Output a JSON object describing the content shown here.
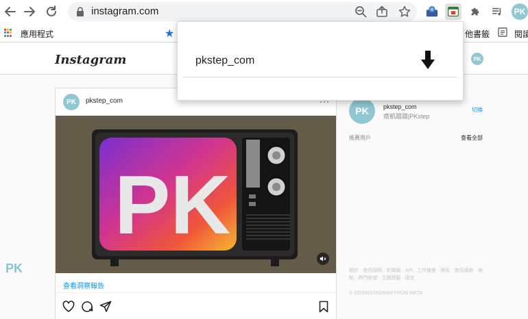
{
  "browser": {
    "url": "instagram.com",
    "bookmarks": {
      "apps_label": "應用程式",
      "right_label_1": "他書籤",
      "right_label_2": "閱讀"
    },
    "colors": {
      "accent": "#1a73e8",
      "omnibox": "#f1f3f4"
    }
  },
  "instagram": {
    "logo": "Instagram",
    "header_avatar": "PK",
    "post": {
      "avatar": "PK",
      "username": "pkstep_com",
      "more": "···",
      "media_logo": "PK",
      "insights_link": "查看洞察報告"
    },
    "sidebar": {
      "avatar": "PK",
      "username": "pkstep_com",
      "full_name": "痞凱踏踏|PKstep",
      "switch_label": "切換",
      "suggestions_label": "推薦用戶",
      "see_all_label": "查看全部",
      "footer_links": "關於 · 使用說明 · 新聞報 · API · 工作機會 · 隱私 · 使用條款 · 地點 · 熱門帳號 · 主題標籤 · 語言",
      "copyright": "© 2022INSTAGRAM FROM META"
    },
    "colors": {
      "link": "#0095f6",
      "avatar": "#8fc7d2"
    }
  },
  "extension_popup": {
    "username": "pkstep_com",
    "download_icon": "download-arrow-icon"
  },
  "watermark": {
    "text": "PK"
  }
}
